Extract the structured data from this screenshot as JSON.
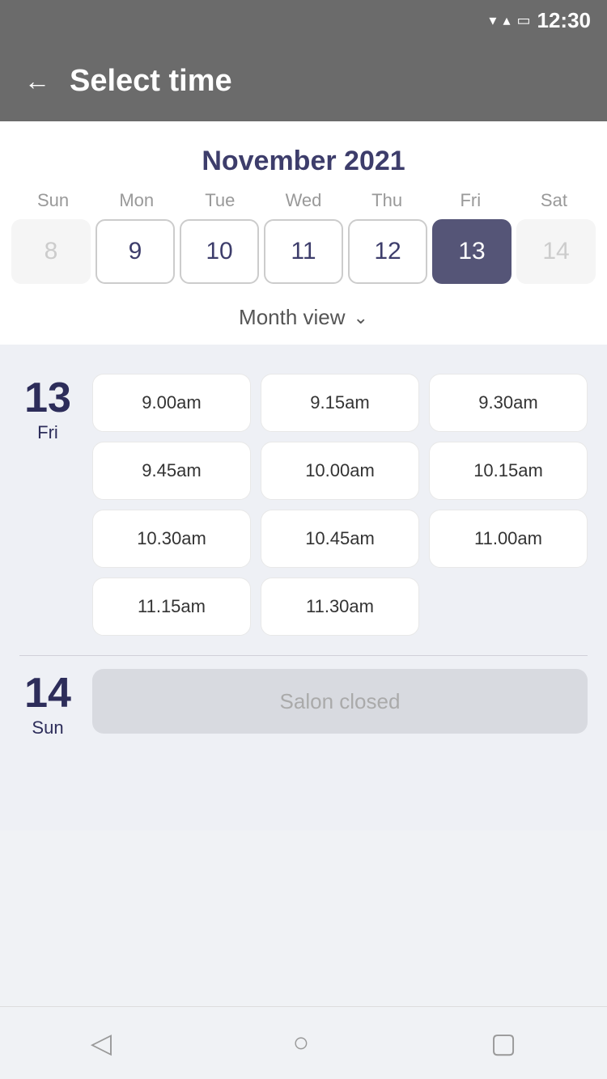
{
  "statusBar": {
    "time": "12:30",
    "wifiIcon": "▼",
    "signalIcon": "▲",
    "batteryIcon": "🔋"
  },
  "header": {
    "backLabel": "←",
    "title": "Select time"
  },
  "calendar": {
    "monthTitle": "November 2021",
    "dayHeaders": [
      "Sun",
      "Mon",
      "Tue",
      "Wed",
      "Thu",
      "Fri",
      "Sat"
    ],
    "weekDays": [
      {
        "label": "8",
        "state": "muted"
      },
      {
        "label": "9",
        "state": "outlined"
      },
      {
        "label": "10",
        "state": "outlined"
      },
      {
        "label": "11",
        "state": "outlined"
      },
      {
        "label": "12",
        "state": "outlined"
      },
      {
        "label": "13",
        "state": "selected"
      },
      {
        "label": "14",
        "state": "muted"
      }
    ],
    "monthViewLabel": "Month view",
    "chevron": "⌄"
  },
  "dayBlocks": [
    {
      "dayNumber": "13",
      "dayName": "Fri",
      "timeSlots": [
        "9.00am",
        "9.15am",
        "9.30am",
        "9.45am",
        "10.00am",
        "10.15am",
        "10.30am",
        "10.45am",
        "11.00am",
        "11.15am",
        "11.30am"
      ],
      "closed": false
    },
    {
      "dayNumber": "14",
      "dayName": "Sun",
      "timeSlots": [],
      "closed": true,
      "closedLabel": "Salon closed"
    }
  ],
  "bottomNav": {
    "backIcon": "◁",
    "homeIcon": "○",
    "recentIcon": "▢"
  }
}
